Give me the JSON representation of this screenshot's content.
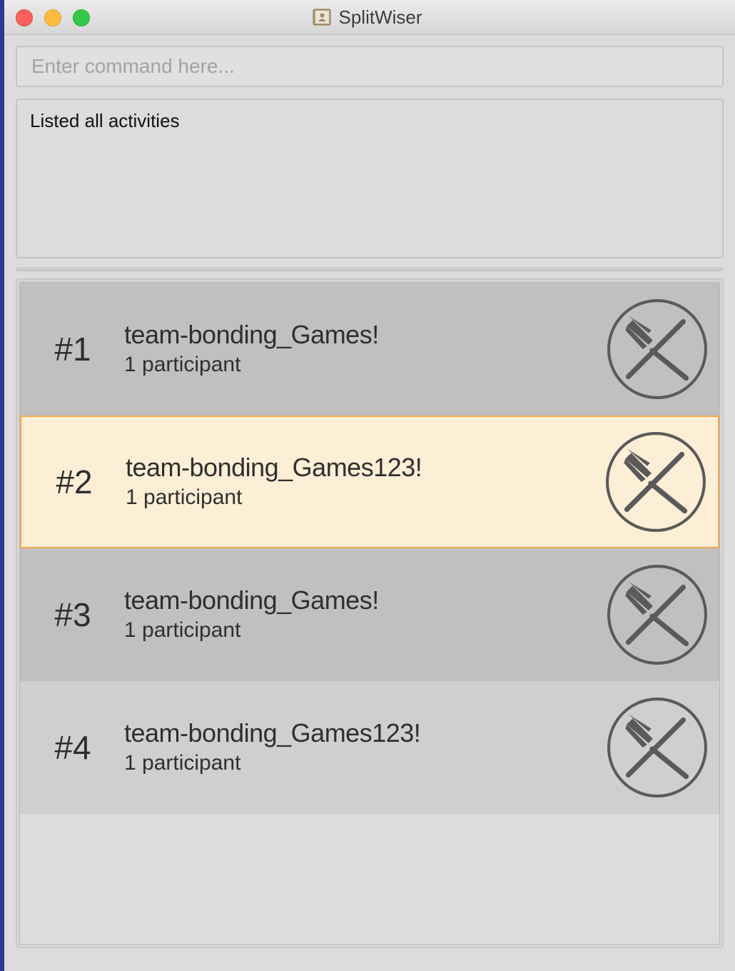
{
  "window": {
    "title": "SplitWiser",
    "app_icon": "contacts-book-icon"
  },
  "command": {
    "placeholder": "Enter command here...",
    "value": ""
  },
  "result": {
    "message": "Listed all activities"
  },
  "activities": [
    {
      "index": "#1",
      "title": "team-bonding_Games!",
      "participants": "1 participant",
      "icon": "fork-knife-icon",
      "selected": false
    },
    {
      "index": "#2",
      "title": "team-bonding_Games123!",
      "participants": "1 participant",
      "icon": "fork-knife-icon",
      "selected": true
    },
    {
      "index": "#3",
      "title": "team-bonding_Games!",
      "participants": "1 participant",
      "icon": "fork-knife-icon",
      "selected": false
    },
    {
      "index": "#4",
      "title": "team-bonding_Games123!",
      "participants": "1 participant",
      "icon": "fork-knife-icon",
      "selected": false
    }
  ],
  "colors": {
    "selected_background": "#fdeed6",
    "selected_border": "#f3a74f",
    "icon_stroke": "#5a5a5a"
  }
}
